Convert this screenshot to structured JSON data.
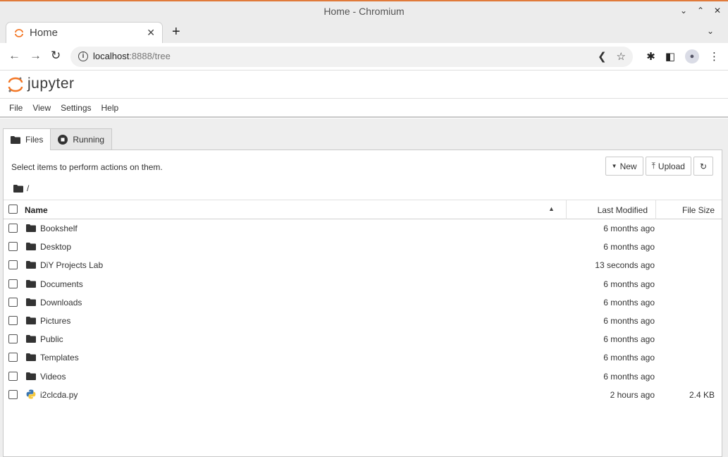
{
  "window": {
    "title": "Home - Chromium"
  },
  "browser": {
    "tab_title": "Home",
    "url_host": "localhost",
    "url_path": ":8888/tree"
  },
  "jupyter": {
    "logo_text": "jupyter",
    "brand_color": "#f37726"
  },
  "menu": {
    "items": [
      "File",
      "View",
      "Settings",
      "Help"
    ]
  },
  "tabs": {
    "files": "Files",
    "running": "Running"
  },
  "panel": {
    "hint": "Select items to perform actions on them.",
    "new_label": "New",
    "upload_label": "Upload",
    "breadcrumb": "/"
  },
  "columns": {
    "name": "Name",
    "last_modified": "Last Modified",
    "file_size": "File Size"
  },
  "files": [
    {
      "name": "Bookshelf",
      "type": "folder",
      "modified": "6 months ago",
      "size": ""
    },
    {
      "name": "Desktop",
      "type": "folder",
      "modified": "6 months ago",
      "size": ""
    },
    {
      "name": "DiY Projects Lab",
      "type": "folder",
      "modified": "13 seconds ago",
      "size": ""
    },
    {
      "name": "Documents",
      "type": "folder",
      "modified": "6 months ago",
      "size": ""
    },
    {
      "name": "Downloads",
      "type": "folder",
      "modified": "6 months ago",
      "size": ""
    },
    {
      "name": "Pictures",
      "type": "folder",
      "modified": "6 months ago",
      "size": ""
    },
    {
      "name": "Public",
      "type": "folder",
      "modified": "6 months ago",
      "size": ""
    },
    {
      "name": "Templates",
      "type": "folder",
      "modified": "6 months ago",
      "size": ""
    },
    {
      "name": "Videos",
      "type": "folder",
      "modified": "6 months ago",
      "size": ""
    },
    {
      "name": "i2clcda.py",
      "type": "python",
      "modified": "2 hours ago",
      "size": "2.4 KB"
    }
  ]
}
